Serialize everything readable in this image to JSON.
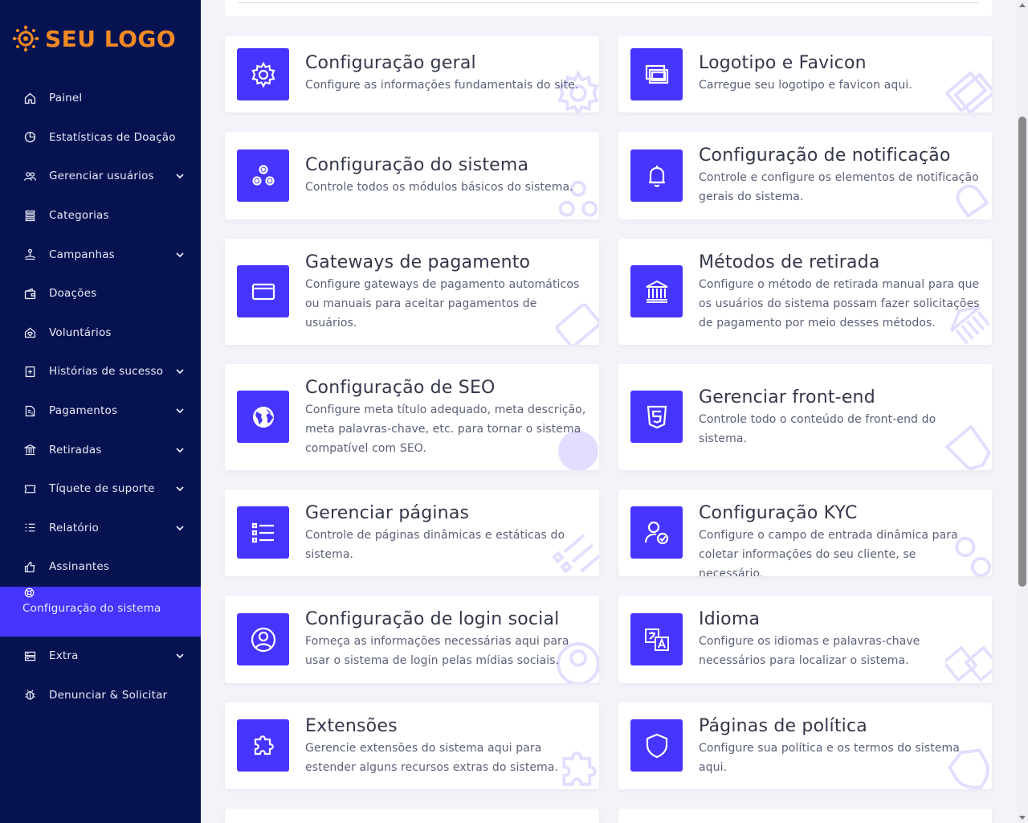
{
  "brand": {
    "logo_text": "SEU LOGO",
    "logo_color": "#f08a24"
  },
  "colors": {
    "sidebar_bg": "#071251",
    "accent": "#4634ff",
    "page_bg": "#f3f3f9"
  },
  "sidebar": {
    "items": [
      {
        "label": "Painel",
        "icon": "home-icon",
        "expandable": false
      },
      {
        "label": "Estatísticas de Doação",
        "icon": "chart-pie-icon",
        "expandable": false
      },
      {
        "label": "Gerenciar usuários",
        "icon": "users-icon",
        "expandable": true
      },
      {
        "label": "Categorias",
        "icon": "layers-icon",
        "expandable": false
      },
      {
        "label": "Campanhas",
        "icon": "campaign-icon",
        "expandable": true
      },
      {
        "label": "Doações",
        "icon": "wallet-icon",
        "expandable": false
      },
      {
        "label": "Voluntários",
        "icon": "volunteer-icon",
        "expandable": false
      },
      {
        "label": "Histórias de sucesso",
        "icon": "story-icon",
        "expandable": true
      },
      {
        "label": "Pagamentos",
        "icon": "invoice-icon",
        "expandable": true
      },
      {
        "label": "Retiradas",
        "icon": "bank-icon",
        "expandable": true
      },
      {
        "label": "Tíquete de suporte",
        "icon": "ticket-icon",
        "expandable": true
      },
      {
        "label": "Relatório",
        "icon": "list-icon",
        "expandable": true
      },
      {
        "label": "Assinantes",
        "icon": "thumbs-up-icon",
        "expandable": false
      },
      {
        "label": "Configuração do sistema",
        "icon": "lifebuoy-icon",
        "expandable": false,
        "active": true
      },
      {
        "label": "Extra",
        "icon": "server-icon",
        "expandable": true
      },
      {
        "label": "Denunciar & Solicitar",
        "icon": "bug-icon",
        "expandable": false
      }
    ]
  },
  "settings": [
    {
      "title": "Configuração geral",
      "description": "Configure as informações fundamentais do site.",
      "icon": "gear-icon"
    },
    {
      "title": "Logotipo e Favicon",
      "description": "Carregue seu logotipo e favicon aqui.",
      "icon": "images-icon"
    },
    {
      "title": "Configuração do sistema",
      "description": "Controle todos os módulos básicos do sistema.",
      "icon": "cogs-icon"
    },
    {
      "title": "Configuração de notificação",
      "description": "Controle e configure os elementos de notificação gerais do sistema.",
      "icon": "bell-icon"
    },
    {
      "title": "Gateways de pagamento",
      "description": "Configure gateways de pagamento automáticos ou manuais para aceitar pagamentos de usuários.",
      "icon": "credit-card-icon"
    },
    {
      "title": "Métodos de retirada",
      "description": "Configure o método de retirada manual para que os usuários do sistema possam fazer solicitações de pagamento por meio desses métodos.",
      "icon": "bank-icon"
    },
    {
      "title": "Configuração de SEO",
      "description": "Configure meta título adequado, meta descrição, meta palavras-chave, etc. para tornar o sistema compatível com SEO.",
      "icon": "globe-icon"
    },
    {
      "title": "Gerenciar front-end",
      "description": "Controle todo o conteúdo de front-end do sistema.",
      "icon": "html5-icon"
    },
    {
      "title": "Gerenciar páginas",
      "description": "Controle de páginas dinâmicas e estáticas do sistema.",
      "icon": "list-icon"
    },
    {
      "title": "Configuração KYC",
      "description": "Configure o campo de entrada dinâmica para coletar informações do seu cliente, se necessário.",
      "icon": "user-check-icon"
    },
    {
      "title": "Configuração de login social",
      "description": "Forneça as informações necessárias aqui para usar o sistema de login pelas mídias sociais.",
      "icon": "user-circle-icon"
    },
    {
      "title": "Idioma",
      "description": "Configure os idiomas e palavras-chave necessários para localizar o sistema.",
      "icon": "language-icon"
    },
    {
      "title": "Extensões",
      "description": "Gerencie extensões do sistema aqui para estender alguns recursos extras do sistema.",
      "icon": "puzzle-icon"
    },
    {
      "title": "Páginas de política",
      "description": "Configure sua política e os termos do sistema aqui.",
      "icon": "shield-icon"
    }
  ]
}
